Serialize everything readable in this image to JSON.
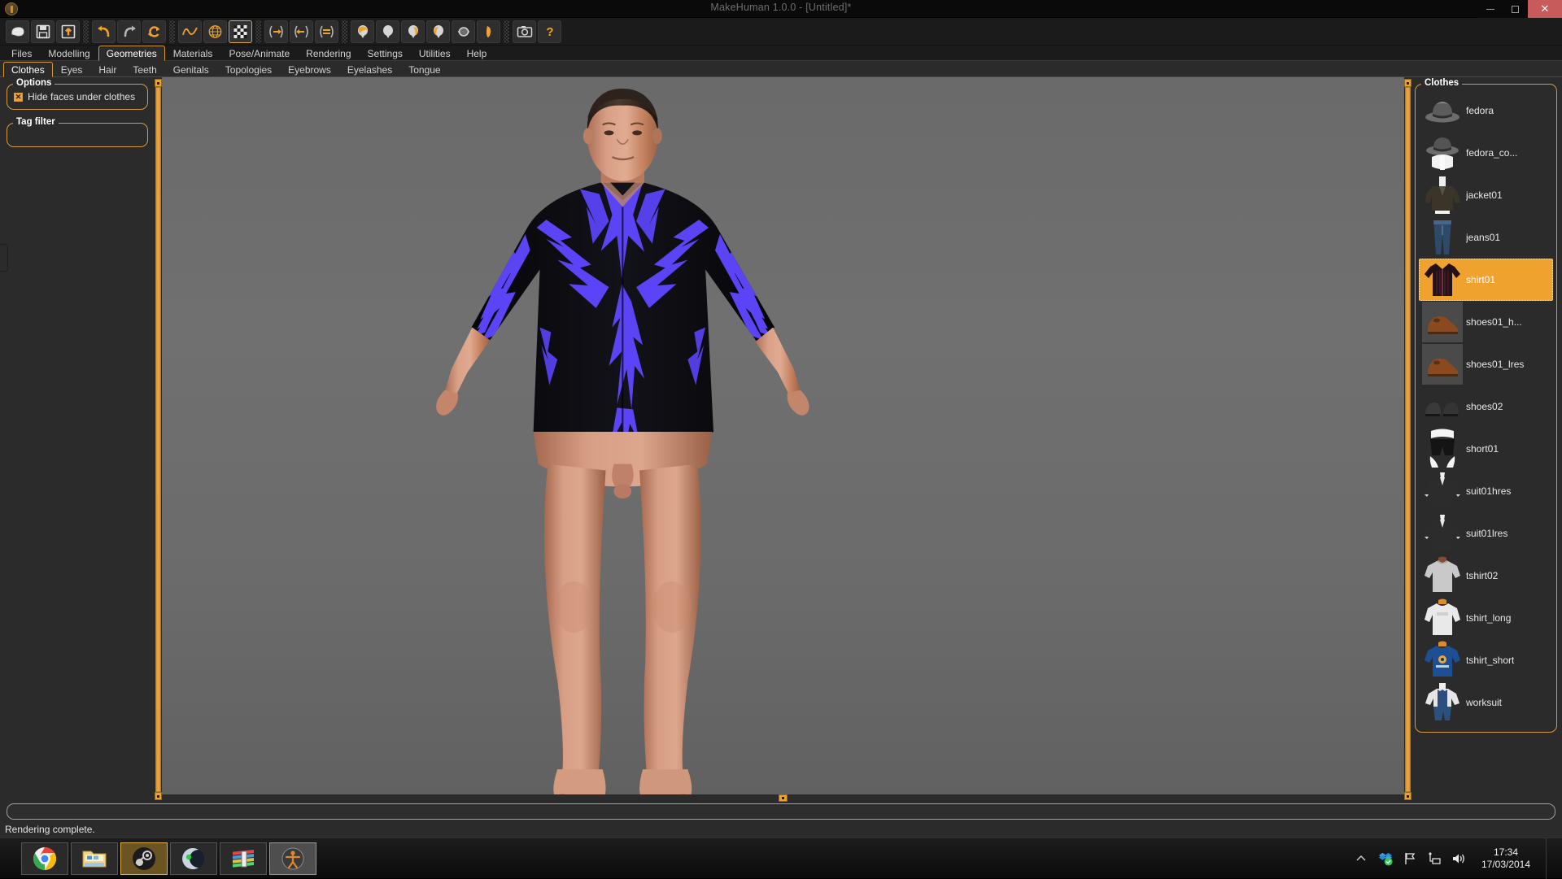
{
  "window": {
    "title": "MakeHuman 1.0.0 - [Untitled]*",
    "logo_icon": "makehuman-logo-icon",
    "minimize_label": "minimize-icon",
    "maximize_label": "maximize-icon",
    "close_label": "✕"
  },
  "toolbar": {
    "groups": [
      {
        "buttons": [
          {
            "name": "new-file-button",
            "icon": "new-document-icon",
            "active": false
          },
          {
            "name": "save-file-button",
            "icon": "floppy-save-icon",
            "active": false
          },
          {
            "name": "load-file-button",
            "icon": "load-import-icon",
            "active": false
          }
        ]
      },
      {
        "buttons": [
          {
            "name": "undo-button",
            "icon": "undo-arrow-icon",
            "active": false
          },
          {
            "name": "redo-button",
            "icon": "redo-arrow-icon",
            "active": false
          },
          {
            "name": "reset-mesh-button",
            "icon": "reset-refresh-icon",
            "active": false
          }
        ]
      },
      {
        "buttons": [
          {
            "name": "smooth-button",
            "icon": "smooth-curve-icon",
            "active": false
          },
          {
            "name": "wireframe-button",
            "icon": "wireframe-globe-icon",
            "active": false
          },
          {
            "name": "subdivide-button",
            "icon": "checker-grid-icon",
            "active": true
          }
        ]
      },
      {
        "buttons": [
          {
            "name": "symmetry-right-button",
            "icon": "symmetry-right-icon",
            "active": false
          },
          {
            "name": "symmetry-left-button",
            "icon": "symmetry-left-icon",
            "active": false
          },
          {
            "name": "symmetry-button",
            "icon": "symmetry-equal-icon",
            "active": false
          }
        ]
      },
      {
        "buttons": [
          {
            "name": "front-view-button",
            "icon": "head-front-icon",
            "active": false
          },
          {
            "name": "back-view-button",
            "icon": "head-back-icon",
            "active": false
          },
          {
            "name": "left-view-button",
            "icon": "head-left-icon",
            "active": false
          },
          {
            "name": "right-view-button",
            "icon": "head-right-icon",
            "active": false
          },
          {
            "name": "top-view-button",
            "icon": "head-top-icon",
            "active": false
          },
          {
            "name": "bottom-view-button",
            "icon": "head-bottom-icon",
            "active": false
          }
        ]
      },
      {
        "buttons": [
          {
            "name": "grab-screen-button",
            "icon": "camera-icon",
            "active": false
          },
          {
            "name": "help-button",
            "icon": "question-mark-icon",
            "active": false
          }
        ]
      }
    ]
  },
  "main_tabs": {
    "selected": "Geometries",
    "items": [
      {
        "label": "Files"
      },
      {
        "label": "Modelling"
      },
      {
        "label": "Geometries"
      },
      {
        "label": "Materials"
      },
      {
        "label": "Pose/Animate"
      },
      {
        "label": "Rendering"
      },
      {
        "label": "Settings"
      },
      {
        "label": "Utilities"
      },
      {
        "label": "Help"
      }
    ]
  },
  "sub_tabs": {
    "selected": "Clothes",
    "items": [
      {
        "label": "Clothes"
      },
      {
        "label": "Eyes"
      },
      {
        "label": "Hair"
      },
      {
        "label": "Teeth"
      },
      {
        "label": "Genitals"
      },
      {
        "label": "Topologies"
      },
      {
        "label": "Eyebrows"
      },
      {
        "label": "Eyelashes"
      },
      {
        "label": "Tongue"
      }
    ]
  },
  "left_panel": {
    "options": {
      "title": "Options",
      "hide_faces_label": "Hide faces under clothes",
      "hide_faces_checked": true,
      "checkbox_glyph": "✕"
    },
    "tag_filter": {
      "title": "Tag filter",
      "items": []
    }
  },
  "right_panel": {
    "title": "Clothes",
    "selected": "shirt01",
    "items": [
      {
        "label": "fedora",
        "thumb": "fedora-hat-thumb"
      },
      {
        "label": "fedora_co...",
        "thumb": "fedora-coat-thumb"
      },
      {
        "label": "jacket01",
        "thumb": "jacket-thumb"
      },
      {
        "label": "jeans01",
        "thumb": "jeans-thumb"
      },
      {
        "label": "shirt01",
        "thumb": "shirt-thumb"
      },
      {
        "label": "shoes01_h...",
        "thumb": "brown-shoe-thumb"
      },
      {
        "label": "shoes01_lres",
        "thumb": "brown-shoe-thumb"
      },
      {
        "label": "shoes02",
        "thumb": "black-shoes-thumb"
      },
      {
        "label": "short01",
        "thumb": "shorts-thumb"
      },
      {
        "label": "suit01hres",
        "thumb": "suit-thumb"
      },
      {
        "label": "suit01lres",
        "thumb": "suit-thumb"
      },
      {
        "label": "tshirt02",
        "thumb": "grey-tshirt-thumb"
      },
      {
        "label": "tshirt_long",
        "thumb": "white-longshirt-thumb"
      },
      {
        "label": "tshirt_short",
        "thumb": "blue-tshirt-thumb"
      },
      {
        "label": "worksuit",
        "thumb": "worksuit-thumb"
      }
    ]
  },
  "viewport": {
    "model_description": "3D human male figure wearing black shirt with blue pattern",
    "background_color": "#6b6b6b",
    "shirt_base_color": "#0a0a10",
    "shirt_pattern_color": "#5a44f5",
    "skin_color": "#c98a6e"
  },
  "status": {
    "message": "Rendering complete.",
    "progress_value": 0
  },
  "taskbar": {
    "items": [
      {
        "name": "taskbar-chrome",
        "icon": "chrome-icon",
        "state": "running"
      },
      {
        "name": "taskbar-explorer",
        "icon": "folder-explorer-icon",
        "state": "running"
      },
      {
        "name": "taskbar-steam",
        "icon": "steam-icon",
        "state": "steam"
      },
      {
        "name": "taskbar-media-player",
        "icon": "moon-media-icon",
        "state": "running"
      },
      {
        "name": "taskbar-winrar",
        "icon": "winrar-books-icon",
        "state": "running"
      },
      {
        "name": "taskbar-makehuman",
        "icon": "makehuman-icon",
        "state": "active"
      }
    ],
    "tray": [
      {
        "name": "tray-show-hidden",
        "icon": "chevron-up-icon"
      },
      {
        "name": "tray-dropbox",
        "icon": "dropbox-icon"
      },
      {
        "name": "tray-action-center",
        "icon": "flag-icon"
      },
      {
        "name": "tray-network",
        "icon": "network-icon"
      },
      {
        "name": "tray-volume",
        "icon": "speaker-icon"
      }
    ],
    "clock": {
      "time": "17:34",
      "date": "17/03/2014"
    }
  },
  "colors": {
    "accent": "#f0a22e",
    "accent_border": "#d79a3b",
    "panel_bg": "#2b2b2b",
    "toolbar_bg": "#1b1b1b",
    "titlebar_bg": "#0a0a0a",
    "close_red": "#c75a5a"
  }
}
